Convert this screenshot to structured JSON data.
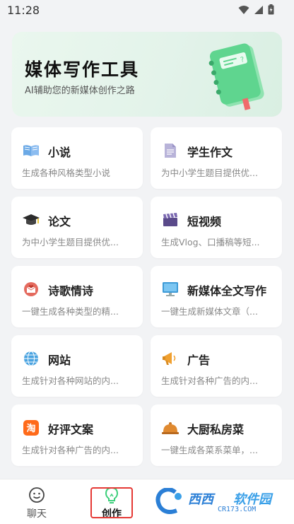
{
  "status_bar": {
    "time": "11:28"
  },
  "banner": {
    "title": "媒体写作工具",
    "subtitle": "AI辅助您的新媒体创作之路"
  },
  "cards": [
    {
      "title": "小说",
      "desc": "生成各种风格类型小说",
      "icon": "open-book-icon"
    },
    {
      "title": "学生作文",
      "desc": "为中小学生题目提供优...",
      "icon": "document-icon"
    },
    {
      "title": "论文",
      "desc": "为中小学生题目提供优...",
      "icon": "graduation-cap-icon"
    },
    {
      "title": "短视频",
      "desc": "生成Vlog、口播稿等短...",
      "icon": "clapperboard-icon"
    },
    {
      "title": "诗歌情诗",
      "desc": "一键生成各种类型的精...",
      "icon": "love-letter-icon"
    },
    {
      "title": "新媒体全文写作",
      "desc": "一键生成新媒体文章（...",
      "icon": "monitor-icon"
    },
    {
      "title": "网站",
      "desc": "生成针对各种网站的内...",
      "icon": "globe-icon"
    },
    {
      "title": "广告",
      "desc": "生成针对各种广告的内...",
      "icon": "megaphone-icon"
    },
    {
      "title": "好评文案",
      "desc": "生成针对各种广告的内...",
      "icon": "taobao-icon"
    },
    {
      "title": "大厨私房菜",
      "desc": "一键生成各菜系菜单，...",
      "icon": "cloche-icon"
    }
  ],
  "tabbar": {
    "chat_label": "聊天",
    "create_label": "创作"
  },
  "watermark": {
    "brand1": "西西",
    "brand2": "软件园",
    "url": "CR173.COM"
  },
  "colors": {
    "accent_green": "#3ccf7a",
    "active_outline": "#e53935"
  }
}
